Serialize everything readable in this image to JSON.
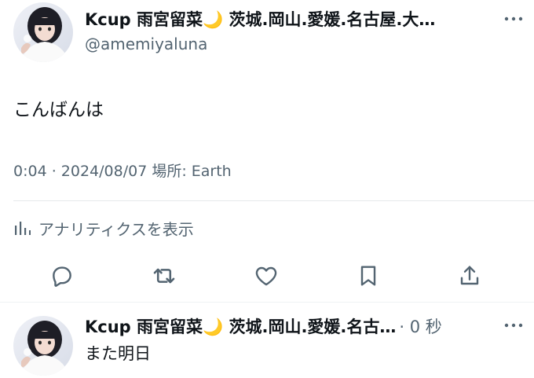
{
  "tweet": {
    "display_name": "Kcup 雨宮留菜🌙 茨城.岡山.愛媛.名古屋.大…",
    "handle": "@amemiyaluna",
    "text": "こんばんは",
    "meta": "0:04 · 2024/08/07 場所: Earth",
    "analytics_label": "アナリティクスを表示",
    "avatar_icon": "profile-photo",
    "more_icon": "more-horizontal-icon"
  },
  "actions": [
    {
      "name": "reply",
      "icon": "reply-icon"
    },
    {
      "name": "retweet",
      "icon": "retweet-icon"
    },
    {
      "name": "like",
      "icon": "heart-icon"
    },
    {
      "name": "bookmark",
      "icon": "bookmark-icon"
    },
    {
      "name": "share",
      "icon": "share-icon"
    }
  ],
  "reply": {
    "display_name": "Kcup 雨宮留菜🌙 茨城.岡山.愛媛.名古…",
    "time": "· 0 秒",
    "text": "また明日"
  },
  "colors": {
    "text": "#0f1419",
    "secondary": "#536471",
    "divider": "#eff3f4",
    "moon": "#f4c542"
  }
}
